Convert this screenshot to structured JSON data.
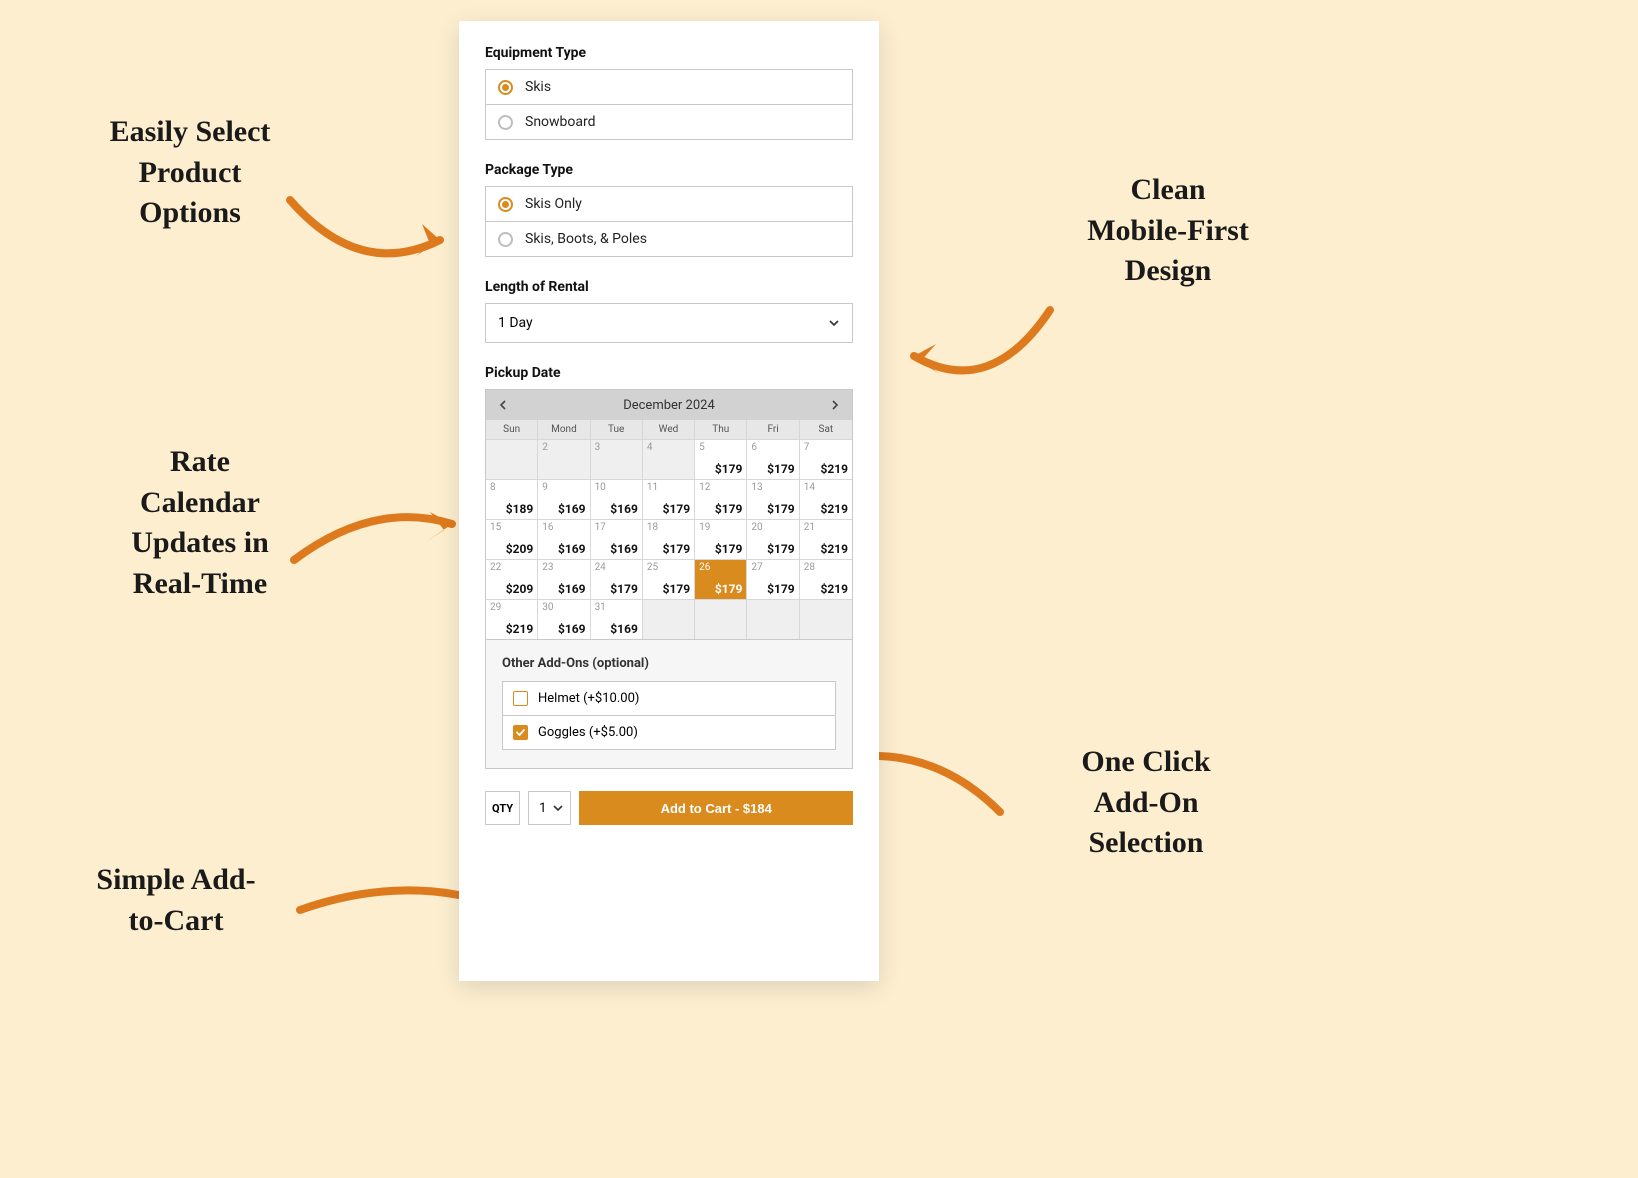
{
  "sections": {
    "equipment": {
      "label": "Equipment Type",
      "options": [
        {
          "label": "Skis",
          "selected": true
        },
        {
          "label": "Snowboard",
          "selected": false
        }
      ]
    },
    "package": {
      "label": "Package Type",
      "options": [
        {
          "label": "Skis Only",
          "selected": true
        },
        {
          "label": "Skis, Boots, & Poles",
          "selected": false
        }
      ]
    },
    "length": {
      "label": "Length of Rental",
      "value": "1 Day"
    },
    "pickup": {
      "label": "Pickup Date",
      "month": "December 2024",
      "dow": [
        "Sun",
        "Mond",
        "Tue",
        "Wed",
        "Thu",
        "Fri",
        "Sat"
      ],
      "cells": [
        {
          "day": "",
          "price": "",
          "state": "empty"
        },
        {
          "day": "2",
          "price": "",
          "state": "disabled"
        },
        {
          "day": "3",
          "price": "",
          "state": "disabled"
        },
        {
          "day": "4",
          "price": "",
          "state": "disabled"
        },
        {
          "day": "5",
          "price": "$179",
          "state": ""
        },
        {
          "day": "6",
          "price": "$179",
          "state": ""
        },
        {
          "day": "7",
          "price": "$219",
          "state": ""
        },
        {
          "day": "8",
          "price": "$189",
          "state": ""
        },
        {
          "day": "9",
          "price": "$169",
          "state": ""
        },
        {
          "day": "10",
          "price": "$169",
          "state": ""
        },
        {
          "day": "11",
          "price": "$179",
          "state": ""
        },
        {
          "day": "12",
          "price": "$179",
          "state": ""
        },
        {
          "day": "13",
          "price": "$179",
          "state": ""
        },
        {
          "day": "14",
          "price": "$219",
          "state": ""
        },
        {
          "day": "15",
          "price": "$209",
          "state": ""
        },
        {
          "day": "16",
          "price": "$169",
          "state": ""
        },
        {
          "day": "17",
          "price": "$169",
          "state": ""
        },
        {
          "day": "18",
          "price": "$179",
          "state": ""
        },
        {
          "day": "19",
          "price": "$179",
          "state": ""
        },
        {
          "day": "20",
          "price": "$179",
          "state": ""
        },
        {
          "day": "21",
          "price": "$219",
          "state": ""
        },
        {
          "day": "22",
          "price": "$209",
          "state": ""
        },
        {
          "day": "23",
          "price": "$169",
          "state": ""
        },
        {
          "day": "24",
          "price": "$179",
          "state": ""
        },
        {
          "day": "25",
          "price": "$179",
          "state": ""
        },
        {
          "day": "26",
          "price": "$179",
          "state": "selected"
        },
        {
          "day": "27",
          "price": "$179",
          "state": ""
        },
        {
          "day": "28",
          "price": "$219",
          "state": ""
        },
        {
          "day": "29",
          "price": "$219",
          "state": ""
        },
        {
          "day": "30",
          "price": "$169",
          "state": ""
        },
        {
          "day": "31",
          "price": "$169",
          "state": ""
        },
        {
          "day": "",
          "price": "",
          "state": "empty"
        },
        {
          "day": "",
          "price": "",
          "state": "empty"
        },
        {
          "day": "",
          "price": "",
          "state": "empty"
        },
        {
          "day": "",
          "price": "",
          "state": "empty"
        }
      ]
    },
    "addons": {
      "label": "Other Add-Ons (optional)",
      "items": [
        {
          "label": "Helmet (+$10.00)",
          "checked": false
        },
        {
          "label": "Goggles (+$5.00)",
          "checked": true
        }
      ]
    },
    "cart": {
      "qty_label": "QTY",
      "qty_value": "1",
      "button_label": "Add to Cart - $184"
    }
  },
  "annotations": {
    "top_left": "Easily Select\nProduct\nOptions",
    "mid_left": "Rate\nCalendar\nUpdates in\nReal-Time",
    "bot_left": "Simple Add-\nto-Cart",
    "top_right": "Clean\nMobile-First\nDesign",
    "bot_right": "One Click\nAdd-On\nSelection"
  }
}
